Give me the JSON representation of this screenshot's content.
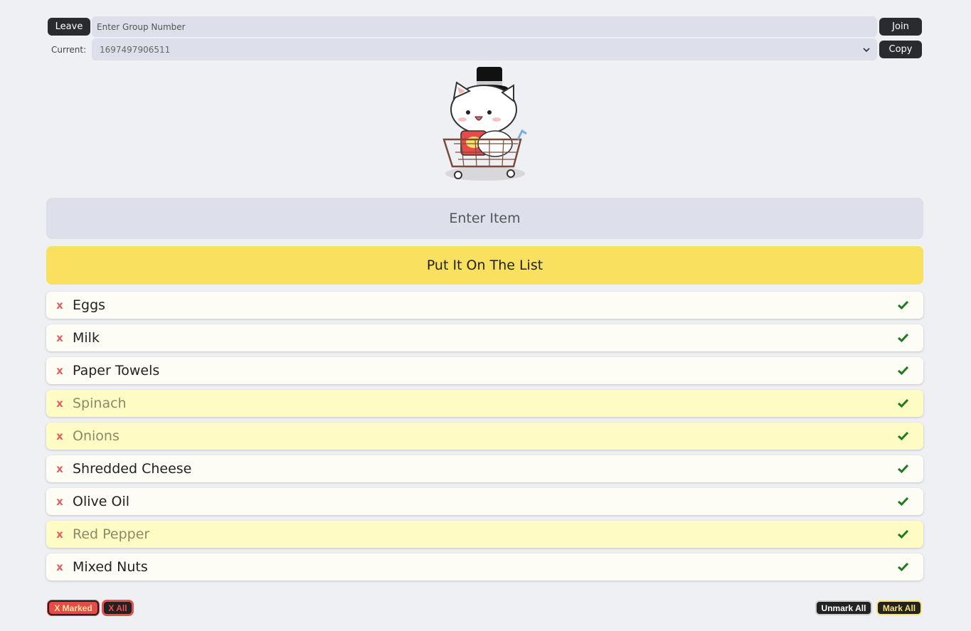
{
  "group": {
    "leave_label": "Leave",
    "input_placeholder": "Enter Group Number",
    "join_label": "Join",
    "current_label": "Current:",
    "current_value": "1697497906511",
    "copy_label": "Copy"
  },
  "entry": {
    "item_placeholder": "Enter Item",
    "add_label": "Put It On The List"
  },
  "items": [
    {
      "label": "Eggs",
      "marked": false
    },
    {
      "label": "Milk",
      "marked": false
    },
    {
      "label": "Paper Towels",
      "marked": false
    },
    {
      "label": "Spinach",
      "marked": true
    },
    {
      "label": "Onions",
      "marked": true
    },
    {
      "label": "Shredded Cheese",
      "marked": false
    },
    {
      "label": "Olive Oil",
      "marked": false
    },
    {
      "label": "Red Pepper",
      "marked": true
    },
    {
      "label": "Mixed Nuts",
      "marked": false
    }
  ],
  "item_icons": {
    "delete": "x",
    "check": "check-icon"
  },
  "footer": {
    "x_marked_label": "X Marked",
    "x_all_label": "X All",
    "unmark_all_label": "Unmark All",
    "mark_all_label": "Mark All"
  },
  "colors": {
    "accent_yellow": "#f9e05e",
    "marked_bg": "#fefcc4",
    "delete_red": "#e46060",
    "check_green": "#1f7a1f"
  }
}
